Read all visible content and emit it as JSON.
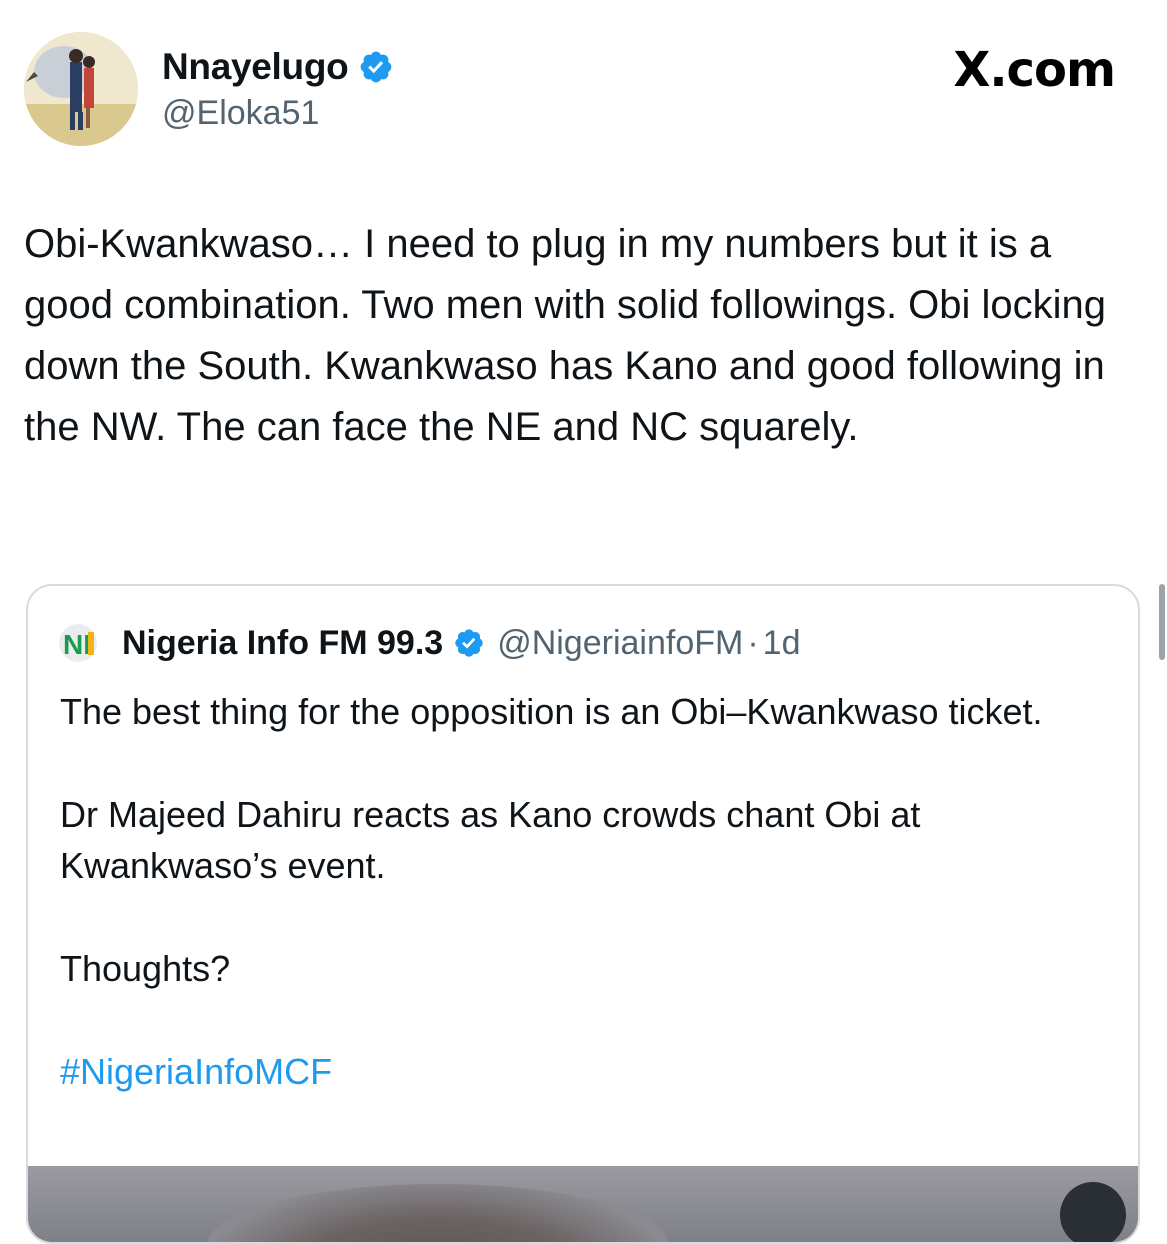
{
  "post": {
    "author_name": "Nnayelugo",
    "author_handle": "@Eloka51",
    "brand": "X.com",
    "text": "Obi-Kwankwaso… I need to plug in my numbers but it is a good combination. Two men with solid followings. Obi locking down the South. Kwankwaso has Kano and good following in the NW. The can face the NE and NC squarely.",
    "verified_icon": "verified-badge-icon",
    "accent_color": "#1d9bf0"
  },
  "quote": {
    "logo_text": "NI",
    "name": "Nigeria Info FM 99.3",
    "handle": "@NigeriainfoFM",
    "separator": "·",
    "time": "1d",
    "paragraphs": [
      "The best thing for the opposition is an Obi–Kwankwaso ticket.",
      "Dr Majeed Dahiru reacts as Kano crowds chant Obi at Kwankwaso’s event.",
      "Thoughts?"
    ],
    "hashtag": "#NigeriaInfoMCF",
    "hashtag_color": "#1d9bf0"
  }
}
